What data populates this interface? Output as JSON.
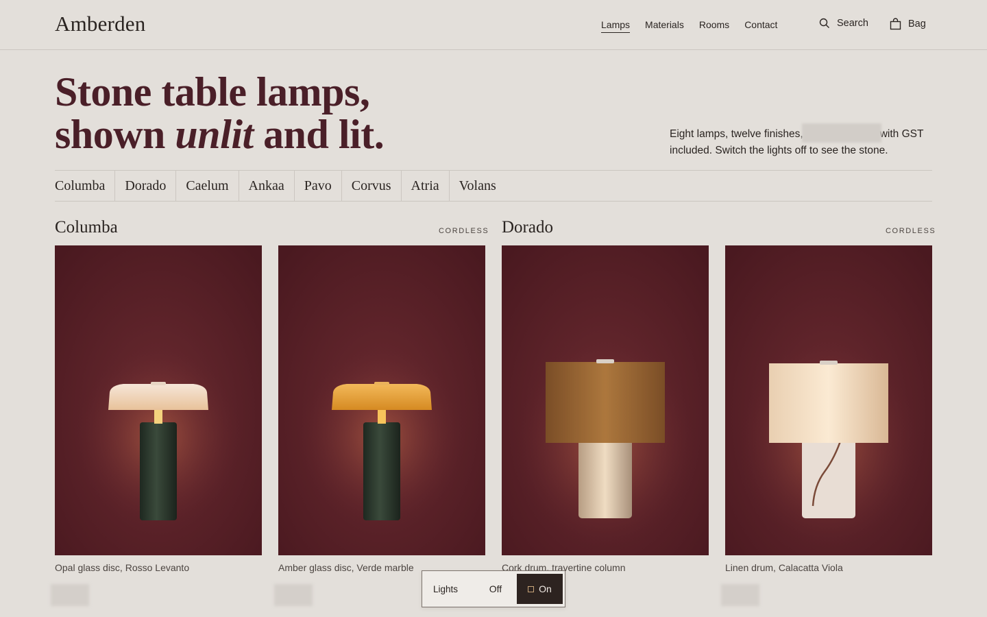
{
  "brand": {
    "name": "Amberden"
  },
  "nav": {
    "items": [
      {
        "label": "Lamps",
        "active": true
      },
      {
        "label": "Materials"
      },
      {
        "label": "Rooms"
      },
      {
        "label": "Contact"
      }
    ],
    "search_label": "Search",
    "bag_label": "Bag"
  },
  "hero": {
    "line1": "Stone table lamps,",
    "line2_pre": "shown ",
    "line2_em": "unlit",
    "line2_post": " and lit.",
    "intro_a": "Eight lamps, twelve finishes,",
    "intro_b": "with GST included. Switch the lights off to see the stone."
  },
  "tabs": [
    "Columba",
    "Dorado",
    "Caelum",
    "Ankaa",
    "Pavo",
    "Corvus",
    "Atria",
    "Volans"
  ],
  "groups": [
    {
      "title": "Columba",
      "badge": "CORDLESS"
    },
    {
      "title": "Dorado",
      "badge": "CORDLESS"
    }
  ],
  "products": [
    {
      "caption": "Opal glass disc, Rosso Levanto"
    },
    {
      "caption": "Amber glass disc, Verde marble"
    },
    {
      "caption": "Cork drum, travertine column"
    },
    {
      "caption": "Linen drum, Calacatta Viola"
    }
  ],
  "lights": {
    "label": "Lights",
    "off": "Off",
    "on": "On",
    "state": "on"
  },
  "colors": {
    "accent": "#4a1f28",
    "background": "#e3dfda",
    "photo_bg": "#5a1f26"
  }
}
